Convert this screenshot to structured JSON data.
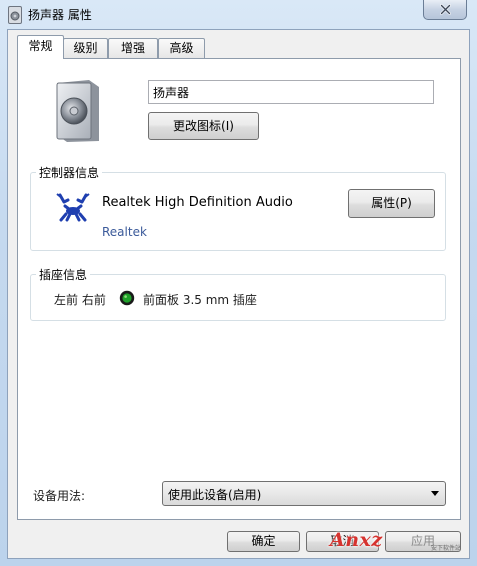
{
  "window": {
    "title": "扬声器 属性"
  },
  "tabs": [
    {
      "label": "常规",
      "active": true
    },
    {
      "label": "级别",
      "active": false
    },
    {
      "label": "增强",
      "active": false
    },
    {
      "label": "高级",
      "active": false
    }
  ],
  "general": {
    "device_name": "扬声器",
    "change_icon_button": "更改图标(I)",
    "controller_group": {
      "label": "控制器信息",
      "driver": "Realtek High Definition Audio",
      "vendor": "Realtek",
      "properties_button": "属性(P)"
    },
    "jack_group": {
      "label": "插座信息",
      "channels": "左前 右前",
      "jack_color": "#1fa02a",
      "location": "前面板 3.5 mm 插座"
    },
    "device_usage": {
      "label": "设备用法:",
      "value": "使用此设备(启用)"
    }
  },
  "footer": {
    "ok": "确定",
    "cancel": "取消",
    "apply": "应用"
  },
  "watermark": {
    "logo": "Anxz",
    "sub": "安下软件站"
  }
}
